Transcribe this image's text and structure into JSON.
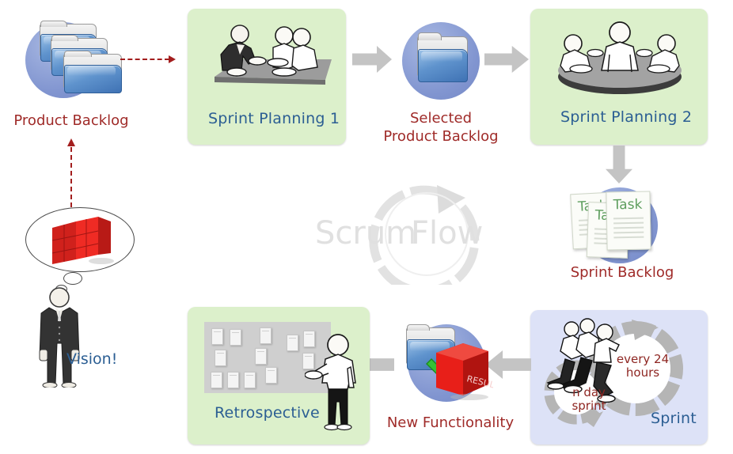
{
  "diagram": {
    "title": "Scrum Flow",
    "watermark_text_1": "Scrum",
    "watermark_text_2": "Flow",
    "colors": {
      "green_panel": "#dcf0cb",
      "blue_panel": "#dde2f7",
      "blue_text": "#2b5e93",
      "red_text": "#9f2a28",
      "gray_arrow": "#c4c4c4",
      "dashed_arrow": "#a31e1e",
      "disc_blue": "#8195d0",
      "watermark_gray": "#e0e0e0"
    }
  },
  "nodes": {
    "product_backlog": {
      "label": "Product Backlog",
      "icon": "stacked-folders-icon"
    },
    "sprint_planning_1": {
      "label": "Sprint Planning 1",
      "icon": "meeting-table-icon"
    },
    "selected_product_backlog": {
      "label": "Selected\nProduct Backlog",
      "icon": "folder-icon"
    },
    "sprint_planning_2": {
      "label": "Sprint Planning 2",
      "icon": "round-table-meeting-icon"
    },
    "sprint_backlog": {
      "label": "Sprint Backlog",
      "icon": "task-cards-icon",
      "card_label": "Task"
    },
    "sprint": {
      "label": "Sprint",
      "icon": "running-team-icon",
      "inner_cycle_label": "n day\nsprint",
      "outer_cycle_label": "every 24\nhours"
    },
    "new_functionality": {
      "label": "New Functionality",
      "icon": "folder-check-result-cube-icon",
      "cube_label": "RESULT"
    },
    "retrospective": {
      "label": "Retrospective",
      "icon": "sticky-note-board-icon"
    },
    "vision": {
      "label": "Vision!",
      "icon": "person-thought-bubble-icon"
    }
  },
  "connectors": [
    {
      "name": "backlog-to-planning1",
      "style": "dashed-red",
      "direction": "right"
    },
    {
      "name": "vision-to-backlog",
      "style": "dashed-red",
      "direction": "up"
    },
    {
      "name": "planning1-to-selected",
      "style": "gray-block",
      "direction": "right"
    },
    {
      "name": "selected-to-planning2",
      "style": "gray-block",
      "direction": "right"
    },
    {
      "name": "planning2-to-sprintbacklog",
      "style": "gray-block",
      "direction": "down"
    },
    {
      "name": "sprintbacklog-to-sprint",
      "style": "gray-block",
      "direction": "down"
    },
    {
      "name": "sprint-to-newfunctionality",
      "style": "gray-block",
      "direction": "left"
    },
    {
      "name": "newfunctionality-to-retrospective",
      "style": "gray-block",
      "direction": "left"
    }
  ]
}
